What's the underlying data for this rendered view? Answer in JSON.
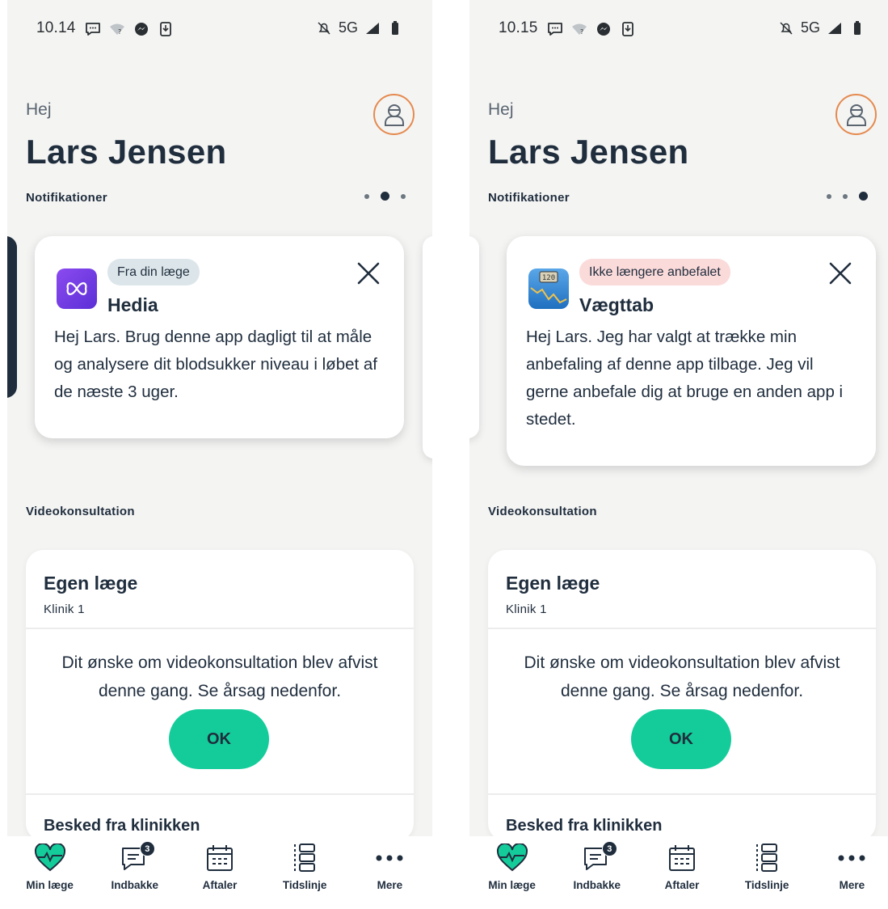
{
  "screens": [
    {
      "status_bar": {
        "time": "10.14",
        "network": "5G"
      },
      "header": {
        "greeting": "Hej",
        "name": "Lars Jensen"
      },
      "notifications": {
        "section_title": "Notifikationer",
        "pager_active_index": 1,
        "pager_count": 3,
        "card": {
          "tag": "Fra din læge",
          "tag_color": "#dce6ea",
          "app_name": "Hedia",
          "app_icon": "hedia-app-icon",
          "text": "Hej Lars. Brug denne app dagligt til at måle og analysere dit blodsukker niveau i løbet af de næste 3 uger."
        }
      },
      "video": {
        "section_title": "Videokonsultation",
        "doctor_title": "Egen læge",
        "clinic": "Klinik 1",
        "message": "Dit ønske om videokonsultation blev afvist denne gang. Se årsag nedenfor.",
        "ok_label": "OK",
        "clinic_message_title": "Besked fra klinikken"
      }
    },
    {
      "status_bar": {
        "time": "10.15",
        "network": "5G"
      },
      "header": {
        "greeting": "Hej",
        "name": "Lars Jensen"
      },
      "notifications": {
        "section_title": "Notifikationer",
        "pager_active_index": 2,
        "pager_count": 3,
        "card": {
          "tag": "Ikke længere anbefalet",
          "tag_color": "#fbdada",
          "app_name": "Vægttab",
          "app_icon": "scale-app-icon",
          "text": "Hej Lars. Jeg har valgt at trække min anbefaling af denne app tilbage. Jeg vil gerne anbefale dig at bruge en anden app i stedet."
        }
      },
      "video": {
        "section_title": "Videokonsultation",
        "doctor_title": "Egen læge",
        "clinic": "Klinik 1",
        "message": "Dit ønske om videokonsultation blev afvist denne gang. Se årsag nedenfor.",
        "ok_label": "OK",
        "clinic_message_title": "Besked fra klinikken"
      }
    }
  ],
  "nav": {
    "items": [
      {
        "label": "Min læge",
        "icon": "heart-pulse-icon"
      },
      {
        "label": "Indbakke",
        "icon": "chat-icon",
        "badge": "3"
      },
      {
        "label": "Aftaler",
        "icon": "calendar-icon"
      },
      {
        "label": "Tidslinje",
        "icon": "timeline-icon"
      },
      {
        "label": "Mere",
        "icon": "more-icon"
      }
    ]
  },
  "colors": {
    "accent": "#14cc9a",
    "text_dark": "#1f2d3d",
    "avatar_ring": "#e58a4e",
    "background": "#f4f4f3"
  }
}
